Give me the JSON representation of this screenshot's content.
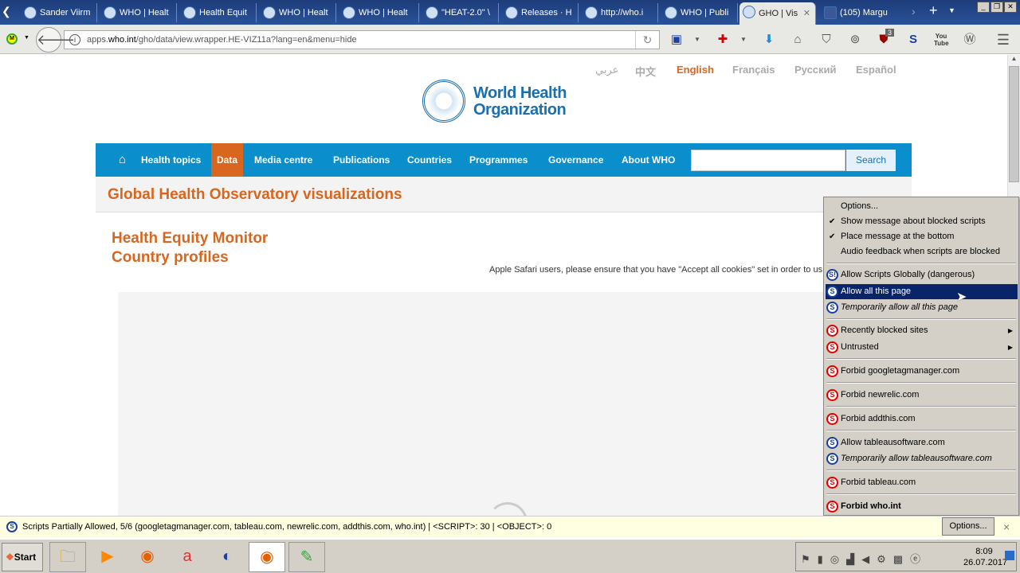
{
  "browser": {
    "tabs": [
      {
        "label": "Sander Viirm"
      },
      {
        "label": "WHO | Healt"
      },
      {
        "label": "Health Equit"
      },
      {
        "label": "WHO | Healt"
      },
      {
        "label": "WHO | Healt"
      },
      {
        "label": "\"HEAT-2.0\" \\"
      },
      {
        "label": "Releases · H"
      },
      {
        "label": "http://who.i"
      },
      {
        "label": "WHO | Publi"
      },
      {
        "label": "GHO | Vis"
      },
      {
        "label": "(105) Margu"
      }
    ],
    "url_prefix": "apps.",
    "url_domain": "who.int",
    "url_rest": "/gho/data/view.wrapper.HE-VIZ11a?lang=en&menu=hide",
    "ublock_badge": "3"
  },
  "site": {
    "languages": [
      "عربي",
      "中文",
      "English",
      "Français",
      "Русский",
      "Español"
    ],
    "logo_line1": "World Health",
    "logo_line2": "Organization",
    "nav": [
      "Health topics",
      "Data",
      "Media centre",
      "Publications",
      "Countries",
      "Programmes",
      "Governance",
      "About WHO"
    ],
    "search_button": "Search",
    "section_title": "Global Health Observatory visualizations",
    "heading1": "Health Equity Monitor",
    "heading2": "Country profiles",
    "safari_note": "Apple Safari users, please ensure that you have \"Accept all cookies\" set in order to us"
  },
  "noscript_menu": {
    "options": "Options...",
    "show_message": "Show message about blocked scripts",
    "place_bottom": "Place message at the bottom",
    "audio": "Audio feedback when scripts are blocked",
    "allow_global": "Allow Scripts Globally (dangerous)",
    "allow_page": "Allow all this page",
    "temp_allow_page": "Temporarily allow all this page",
    "recently_blocked": "Recently blocked sites",
    "untrusted": "Untrusted",
    "forbid_gtm": "Forbid googletagmanager.com",
    "forbid_newrelic": "Forbid newrelic.com",
    "forbid_addthis": "Forbid addthis.com",
    "allow_tableausoftware": "Allow tableausoftware.com",
    "temp_allow_tableausoftware": "Temporarily allow tableausoftware.com",
    "forbid_tableau": "Forbid tableau.com",
    "forbid_who": "Forbid who.int"
  },
  "notification": {
    "text": "Scripts Partially Allowed, 5/6 (googletagmanager.com, tableau.com, newrelic.com, addthis.com, who.int) | <SCRIPT>: 30 | <OBJECT>: 0",
    "options": "Options...",
    "close": "×"
  },
  "taskbar": {
    "start": "Start",
    "time": "8:09",
    "date": "26.07.2017"
  }
}
